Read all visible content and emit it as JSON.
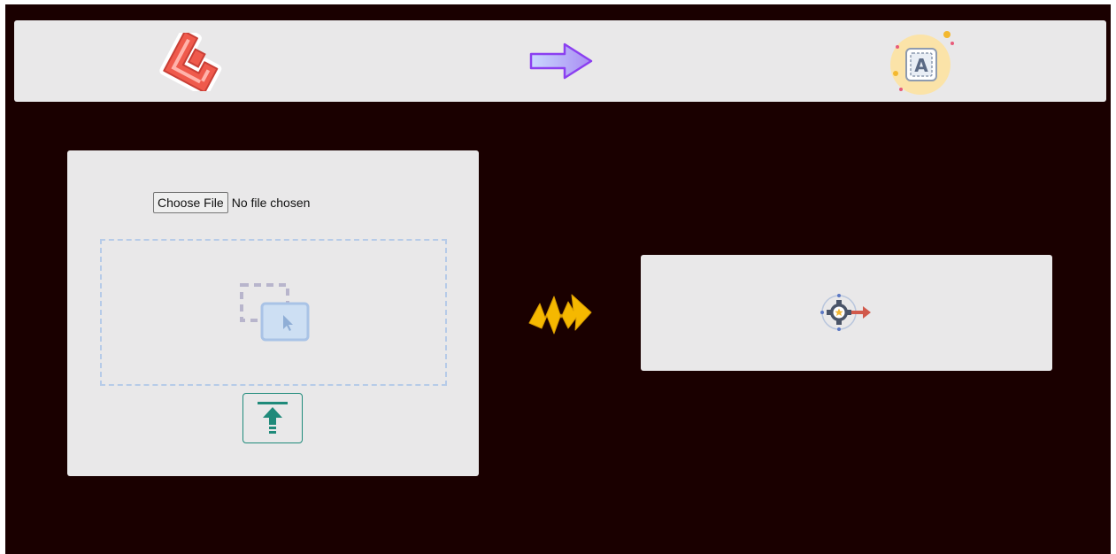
{
  "header": {
    "source_logo_icon": "laravel-logo-icon",
    "convert_arrow_icon": "right-arrow-icon",
    "target_logo_icon": "letter-a-icon",
    "target_logo_letter": "A"
  },
  "upload": {
    "choose_file_label": "Choose File",
    "file_status": "No file chosen",
    "dropzone_icon": "select-area-cursor-icon",
    "upload_button_icon": "upload-arrow-icon"
  },
  "connector": {
    "icon": "lightning-arrow-icon"
  },
  "result": {
    "icon": "gear-process-icon"
  },
  "colors": {
    "background": "#1a0000",
    "panel": "#e9e8e9",
    "accent_teal": "#1f8a7a",
    "dropzone_border": "#b6cbe8",
    "bolt": "#f5b800",
    "laravel_red": "#ef5a4c",
    "arrow_purple": "#9b5cf0"
  }
}
